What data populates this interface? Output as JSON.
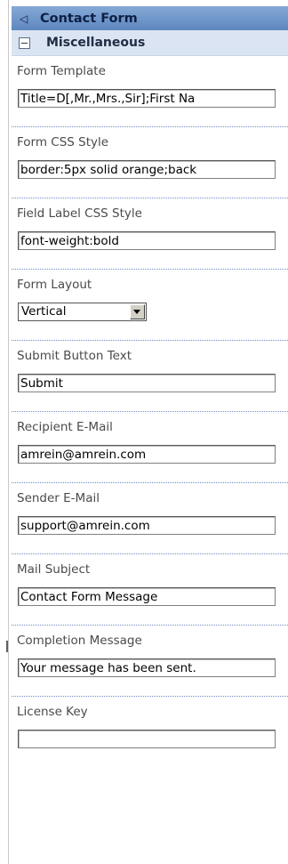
{
  "panel": {
    "title": "Contact Form",
    "section": "Miscellaneous"
  },
  "fields": [
    {
      "label": "Form Template",
      "value": "Title=D[,Mr.,Mrs.,Sir];First Na"
    },
    {
      "label": "Form CSS Style",
      "value": "border:5px solid orange;back"
    },
    {
      "label": "Field Label CSS Style",
      "value": "font-weight:bold"
    },
    {
      "label": "Form Layout",
      "value": "Vertical"
    },
    {
      "label": "Submit Button Text",
      "value": "Submit"
    },
    {
      "label": "Recipient E-Mail",
      "value": "amrein@amrein.com"
    },
    {
      "label": "Sender E-Mail",
      "value": "support@amrein.com"
    },
    {
      "label": "Mail Subject",
      "value": "Contact Form Message"
    },
    {
      "label": "Completion Message",
      "value": "Your message has been sent."
    },
    {
      "label": "License Key",
      "value": ""
    }
  ],
  "colors": {
    "header": "#6f98cc",
    "section": "#dbe4f2",
    "divider": "#6e8fc8"
  }
}
